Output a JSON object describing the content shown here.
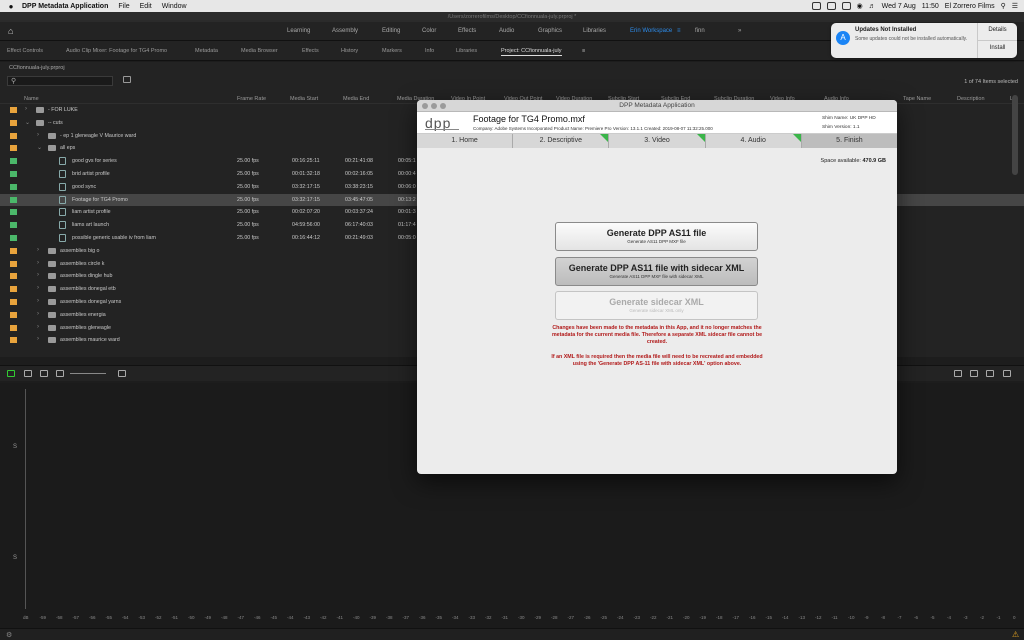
{
  "menubar": {
    "apple": "",
    "app": "DPP Metadata Application",
    "items": [
      "File",
      "Edit",
      "Window"
    ],
    "date": "Wed 7 Aug",
    "time": "11:50",
    "user": "El Zorrero Films"
  },
  "titlebar": {
    "path": "/Users/zorrerofilms/Desktop/CCfionnuala-july.prproj *"
  },
  "workspaces": {
    "items": [
      "Learning",
      "Assembly",
      "Editing",
      "Color",
      "Effects",
      "Audio",
      "Graphics",
      "Libraries",
      "Erin Workspace",
      "finn"
    ],
    "active": "Erin Workspace",
    "more": "»"
  },
  "panel_tabs": {
    "items": [
      "Effect Controls",
      "Audio Clip Mixer: Footage for TG4 Promo",
      "Metadata",
      "Media Browser",
      "Effects",
      "History",
      "Markers",
      "Info",
      "Libraries",
      "Project: CCfionnuala-july"
    ],
    "active": "Project: CCfionnuala-july"
  },
  "project": {
    "file": "CCfionnuala-july.prproj",
    "item_count": "1 of 74 Items selected",
    "columns": [
      "Name",
      "Frame Rate",
      "Media Start",
      "Media End",
      "Media Duration",
      "Video In Point",
      "Video Out Point",
      "Video Duration",
      "Subclip Start",
      "Subclip End",
      "Subclip Duration",
      "Video Info",
      "Audio Info",
      "Tape Name",
      "Description",
      "Lo"
    ],
    "rows": [
      {
        "name": "- FOR LUKE",
        "type": "folder",
        "indent": 1,
        "label_color": "#e8a33c"
      },
      {
        "name": "-- cuts",
        "type": "folder",
        "indent": 1,
        "open": true,
        "label_color": "#e8a33c"
      },
      {
        "name": "- ep 1 gleneagle V Maurice ward",
        "type": "folder",
        "indent": 2,
        "label_color": "#e8a33c"
      },
      {
        "name": "all eps",
        "type": "folder",
        "indent": 2,
        "open": true,
        "label_color": "#e8a33c"
      },
      {
        "name": "good gvs for series",
        "type": "clip",
        "indent": 3,
        "label_color": "#4bb86a",
        "frame_rate": "25.00 fps",
        "start": "00:16:25:11",
        "end": "00:21:41:08",
        "dur": "00:05:1"
      },
      {
        "name": "brid artist profile",
        "type": "clip",
        "indent": 3,
        "label_color": "#4bb86a",
        "frame_rate": "25.00 fps",
        "start": "00:01:32:18",
        "end": "00:02:16:05",
        "dur": "00:00:4"
      },
      {
        "name": "good sync",
        "type": "clip",
        "indent": 3,
        "label_color": "#4bb86a",
        "frame_rate": "25.00 fps",
        "start": "03:32:17:15",
        "end": "03:38:23:15",
        "dur": "00:06:0"
      },
      {
        "name": "Footage for TG4 Promo",
        "type": "clip",
        "indent": 3,
        "label_color": "#4bb86a",
        "frame_rate": "25.00 fps",
        "start": "03:32:17:15",
        "end": "03:45:47:05",
        "dur": "00:13:2",
        "selected": true
      },
      {
        "name": "liam artist profile",
        "type": "clip",
        "indent": 3,
        "label_color": "#4bb86a",
        "frame_rate": "25.00 fps",
        "start": "00:02:07:20",
        "end": "00:03:37:24",
        "dur": "00:01:3"
      },
      {
        "name": "liams art launch",
        "type": "clip",
        "indent": 3,
        "label_color": "#4bb86a",
        "frame_rate": "25.00 fps",
        "start": "04:59:56:00",
        "end": "06:17:40:03",
        "dur": "01:17:4"
      },
      {
        "name": "possible generic usable iv from liam",
        "type": "clip",
        "indent": 3,
        "label_color": "#4bb86a",
        "frame_rate": "25.00 fps",
        "start": "00:16:44:12",
        "end": "00:21:49:03",
        "dur": "00:05:0"
      },
      {
        "name": "assemblies big o",
        "type": "folder",
        "indent": 2,
        "label_color": "#e8a33c"
      },
      {
        "name": "assemblies circle k",
        "type": "folder",
        "indent": 2,
        "label_color": "#e8a33c"
      },
      {
        "name": "assemblies dingle hub",
        "type": "folder",
        "indent": 2,
        "label_color": "#e8a33c"
      },
      {
        "name": "assemblies donegal etb",
        "type": "folder",
        "indent": 2,
        "label_color": "#e8a33c"
      },
      {
        "name": "assemblies donegal yarns",
        "type": "folder",
        "indent": 2,
        "label_color": "#e8a33c"
      },
      {
        "name": "assemblies energia",
        "type": "folder",
        "indent": 2,
        "label_color": "#e8a33c"
      },
      {
        "name": "assemblies gleneagle",
        "type": "folder",
        "indent": 2,
        "label_color": "#e8a33c"
      },
      {
        "name": "assemblies maurice ward",
        "type": "folder",
        "indent": 2,
        "label_color": "#e8a33c"
      }
    ]
  },
  "lower": {
    "marker_s1": "S",
    "marker_s2": "S",
    "ruler": [
      "dB",
      "-59",
      "-58",
      "-57",
      "-56",
      "-55",
      "-54",
      "-53",
      "-52",
      "-51",
      "-50",
      "-49",
      "-48",
      "-47",
      "-46",
      "-45",
      "-44",
      "-43",
      "-42",
      "-41",
      "-40",
      "-39",
      "-38",
      "-37",
      "-36",
      "-35",
      "-34",
      "-33",
      "-32",
      "-31",
      "-30",
      "-29",
      "-28",
      "-27",
      "-26",
      "-25",
      "-24",
      "-23",
      "-22",
      "-21",
      "-20",
      "-19",
      "-18",
      "-17",
      "-16",
      "-15",
      "-14",
      "-13",
      "-12",
      "-11",
      "-10",
      "-9",
      "-8",
      "-7",
      "-6",
      "-5",
      "-4",
      "-3",
      "-2",
      "-1",
      "0"
    ]
  },
  "notification": {
    "title": "Updates Not Installed",
    "body": "Some updates could not be installed automatically.",
    "details": "Details",
    "install": "Install"
  },
  "dpp": {
    "window_title": "DPP Metadata Application",
    "logo": "dpp",
    "file_name": "Footage for TG4 Promo.mxf",
    "meta": "Company: Adobe Systems Incorporated  Product Name: Premiere Pro  Version: 13.1.1  Created: 2019-08-07 11:32:25.000",
    "shim_name": "Shim Name: UK DPP HD",
    "shim_version": "Shim Version: 1.1",
    "steps": [
      {
        "label": "1. Home",
        "done": false
      },
      {
        "label": "2. Descriptive",
        "done": true
      },
      {
        "label": "3. Video",
        "done": true
      },
      {
        "label": "4. Audio",
        "done": true
      },
      {
        "label": "5. Finish",
        "done": false,
        "active": true
      }
    ],
    "space_label": "Space available:",
    "space_value": "470.9 GB",
    "btn1": {
      "main": "Generate DPP AS11 file",
      "sub": "Generate AS11 DPP MXF file"
    },
    "btn2": {
      "main": "Generate DPP AS11 file with sidecar XML",
      "sub": "Generate AS11 DPP MXF file with sidecar XML"
    },
    "btn3": {
      "main": "Generate sidecar XML",
      "sub": "Generate sidecar XML only"
    },
    "warn1": "Changes have been made to the metadata in this App, and it no longer matches the metadata for the current media file. Therefore a separate XML sidecar file cannot be created.",
    "warn2": "If an XML file is required then the media file will need to be recreated and embedded using the 'Generate DPP AS-11 file with sidecar XML' option above."
  },
  "colors": {
    "accent": "#2d8ceb",
    "warning": "#b11a1a",
    "done": "#3bb54a"
  }
}
